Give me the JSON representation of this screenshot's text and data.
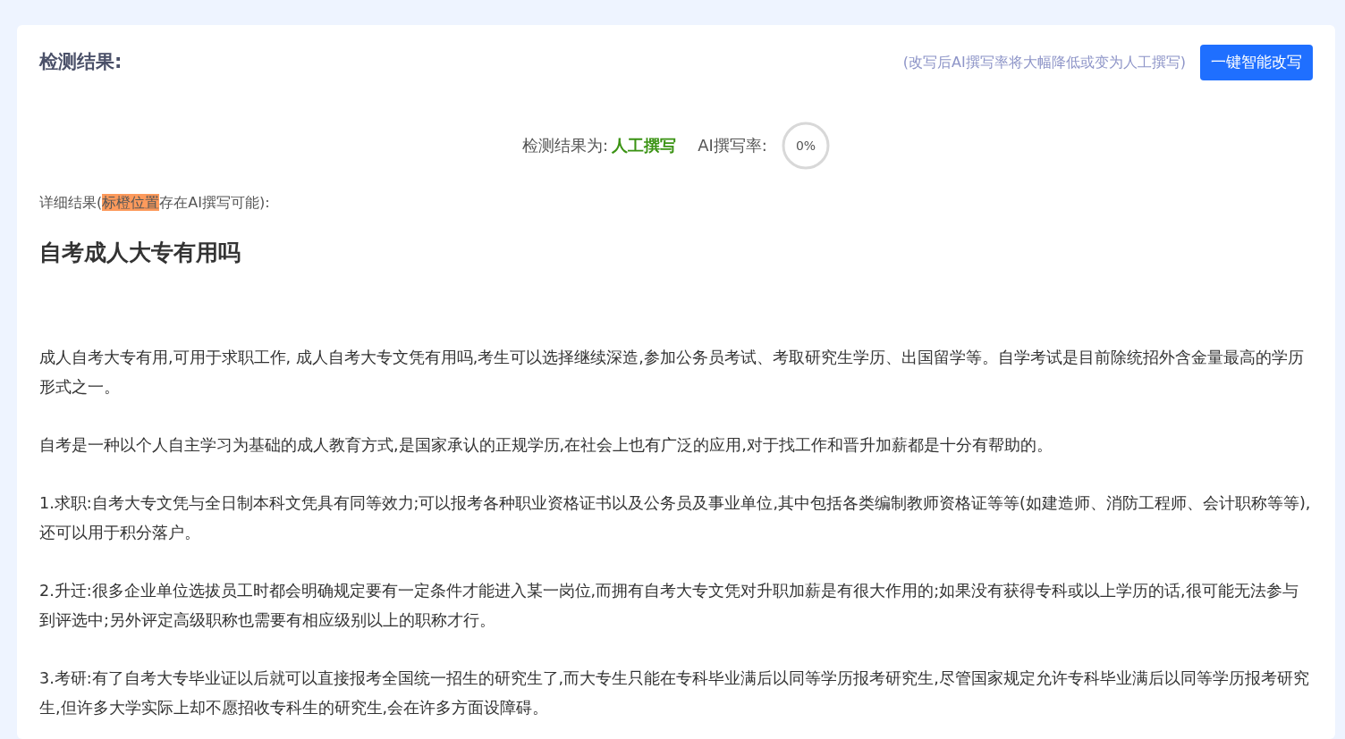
{
  "header": {
    "title": "检测结果:",
    "hint": "(改写后AI撰写率将大幅降低或变为人工撰写)",
    "button": "一键智能改写"
  },
  "summary": {
    "result_label": "检测结果为:",
    "result": "人工撰写",
    "rate_label": "AI撰写率:",
    "rate": "0%"
  },
  "detail_label": {
    "before": "详细结果(",
    "highlight": "标橙位置",
    "after": "存在AI撰写可能):"
  },
  "article": {
    "title": "自考成人大专有用吗",
    "paragraphs": [
      "成人自考大专有用,可用于求职工作, 成人自考大专文凭有用吗,考生可以选择继续深造,参加公务员考试、考取研究生学历、出国留学等。自学考试是目前除统招外含金量最高的学历形式之一。",
      "自考是一种以个人自主学习为基础的成人教育方式,是国家承认的正规学历,在社会上也有广泛的应用,对于找工作和晋升加薪都是十分有帮助的。",
      "1.求职:自考大专文凭与全日制本科文凭具有同等效力;可以报考各种职业资格证书以及公务员及事业单位,其中包括各类编制教师资格证等等(如建造师、消防工程师、会计职称等等),还可以用于积分落户。",
      "2.升迁:很多企业单位选拔员工时都会明确规定要有一定条件才能进入某一岗位,而拥有自考大专文凭对升职加薪是有很大作用的;如果没有获得专科或以上学历的话,很可能无法参与到评选中;另外评定高级职称也需要有相应级别以上的职称才行。",
      "3.考研:有了自考大专毕业证以后就可以直接报考全国统一招生的研究生了,而大专生只能在专科毕业满后以同等学历报考研究生,尽管国家规定允许专科毕业满后以同等学历报考研究生,但许多大学实际上却不愿招收专科生的研究生,会在许多方面设障碍。"
    ]
  }
}
